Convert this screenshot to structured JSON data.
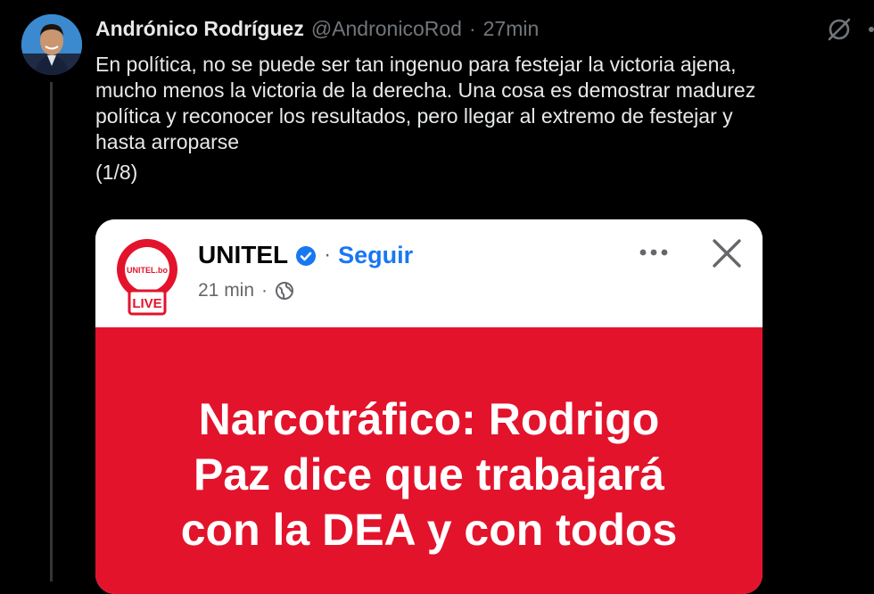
{
  "tweet": {
    "author_name": "Andrónico Rodríguez",
    "handle": "@AndronicoRod",
    "separator": "·",
    "time": "27min",
    "text_lines": [
      "En política, no se puede ser tan ingenuo para festejar la victoria ajena,",
      "mucho menos la victoria de la derecha. Una cosa es demostrar madurez",
      "política y reconocer los resultados, pero llegar al extremo de festejar y",
      "hasta arroparse"
    ],
    "thread_counter": "(1/8)"
  },
  "embed": {
    "page_name": "UNITEL",
    "separator": "·",
    "follow_label": "Seguir",
    "time": "21 min",
    "separator2": "·",
    "logo_text": "UNITEL.bo",
    "live_badge": "LIVE",
    "headline_lines": [
      "Narcotráfico: Rodrigo",
      "Paz dice que trabajará",
      "con la DEA y con todos"
    ]
  },
  "colors": {
    "background": "#000000",
    "unitel_red": "#e3132c",
    "facebook_blue": "#1877f2",
    "muted": "#71767b"
  },
  "icons": [
    "grok-icon",
    "more-icon",
    "verified-icon",
    "globe-icon",
    "more-dots-icon",
    "close-icon"
  ]
}
